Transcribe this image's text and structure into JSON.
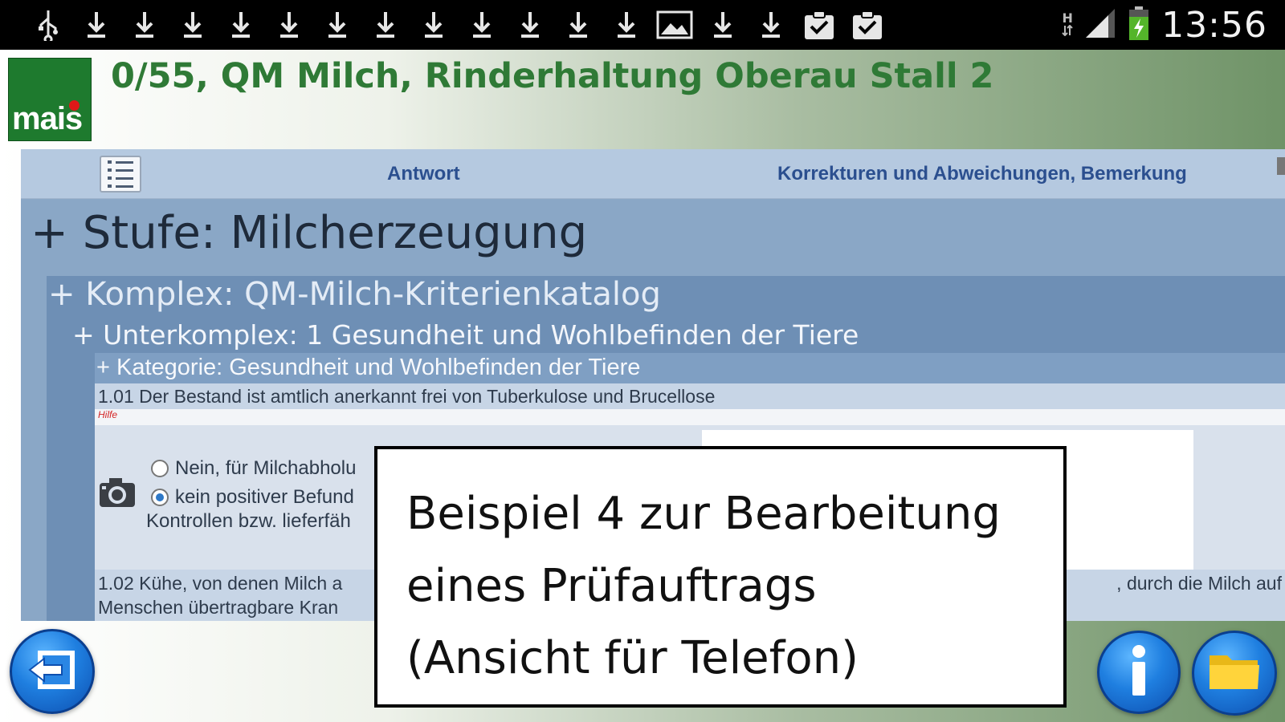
{
  "status_bar": {
    "notification_icons": [
      "usb-icon",
      "download-icon",
      "download-icon",
      "download-icon",
      "download-icon",
      "download-icon",
      "download-icon",
      "download-icon",
      "download-icon",
      "download-icon",
      "download-icon",
      "download-icon",
      "download-icon",
      "image-icon",
      "download-icon",
      "download-icon",
      "clipboard-check-icon",
      "clipboard-check-icon"
    ],
    "network": "H",
    "time": "13:56"
  },
  "header": {
    "logo_text": "mais",
    "title": "0/55, QM Milch, Rinderhaltung Oberau Stall 2"
  },
  "tabs": {
    "antwort": "Antwort",
    "bemerkung": "Korrekturen und Abweichungen, Bemerkung"
  },
  "content": {
    "stufe": "+ Stufe: Milcherzeugung",
    "komplex": "+ Komplex: QM-Milch-Kriterienkatalog",
    "unterkomplex": "+ Unterkomplex: 1 Gesundheit und Wohlbefinden der Tiere",
    "kategorie": "+ Kategorie: Gesundheit und Wohlbefinden der Tiere",
    "q1": "1.01 Der Bestand ist amtlich anerkannt frei von Tuberkulose und Brucellose",
    "hilfe": "Hilfe",
    "option1": "Nein, für Milchabholu",
    "option2": "kein positiver Befund",
    "kontrollen": "Kontrollen bzw. lieferfäh",
    "q2_left": "1.02 Kühe, von denen Milch a",
    "q2_right": ", durch die Milch auf",
    "q2_line2": "Menschen übertragbare Kran"
  },
  "caption": {
    "line1": "Beispiel 4 zur Bearbeitung",
    "line2": "eines Prüfauftrags",
    "line3": "(Ansicht für Telefon)"
  },
  "colors": {
    "title_green": "#2f7a36",
    "logo_green": "#1e7a2e",
    "panel_blue": "#8aa7c6",
    "button_blue": "#1f7fe0"
  }
}
